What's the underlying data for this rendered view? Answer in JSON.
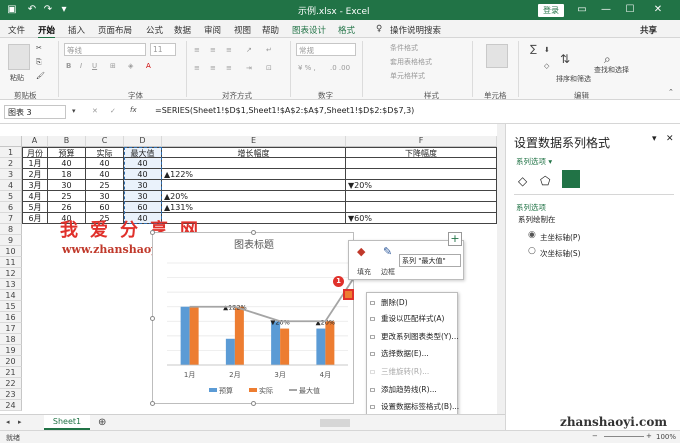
{
  "titlebar": {
    "file_title": "示例.xlsx  -  Excel",
    "login": "登录",
    "restore_icon": "ribbon-display-icon",
    "min": "—",
    "max": "☐",
    "close": "✕"
  },
  "tabs": [
    "文件",
    "开始",
    "插入",
    "页面布局",
    "公式",
    "数据",
    "审阅",
    "视图",
    "帮助",
    "图表设计",
    "格式",
    "操作说明搜索",
    "共享"
  ],
  "ribbon": {
    "paste": "粘贴",
    "clipboard": "剪贴板",
    "font_name": "等线",
    "font_size": "11",
    "font_group": "字体",
    "align_group": "对齐方式",
    "number_format": "常规",
    "number_group": "数字",
    "cond_format": "条件格式",
    "table_format": "套用表格格式",
    "cell_style": "单元格样式",
    "styles_group": "样式",
    "cells": "单元格",
    "sum": "∑",
    "sort_filter": "排序和筛选",
    "find_select": "查找和选择",
    "edit_group": "编辑"
  },
  "formula_bar": {
    "name_box": "图表 3",
    "fx": "fx",
    "formula": "=SERIES(Sheet1!$D$1,Sheet1!$A$2:$A$7,Sheet1!$D$2:$D$7,3)"
  },
  "columns": [
    "A",
    "B",
    "C",
    "D",
    "E",
    "F"
  ],
  "rows": [
    "1",
    "2",
    "3",
    "4",
    "5",
    "6",
    "7",
    "8",
    "9",
    "10",
    "11",
    "12",
    "13",
    "14",
    "15",
    "16",
    "17",
    "18",
    "19",
    "20",
    "21",
    "22",
    "23",
    "24"
  ],
  "table": {
    "headers": [
      "月份",
      "预算",
      "实际",
      "最大值",
      "增长幅度",
      "下降幅度"
    ],
    "data": [
      [
        "1月",
        "40",
        "40",
        "40",
        "",
        ""
      ],
      [
        "2月",
        "18",
        "40",
        "40",
        "▲122%",
        ""
      ],
      [
        "3月",
        "30",
        "25",
        "30",
        "",
        "▼20%"
      ],
      [
        "4月",
        "25",
        "30",
        "30",
        "▲20%",
        ""
      ],
      [
        "5月",
        "26",
        "60",
        "60",
        "▲131%",
        ""
      ],
      [
        "6月",
        "40",
        "25",
        "40",
        "",
        "▼60%"
      ]
    ]
  },
  "watermark": {
    "text": "我爱分享网",
    "url": "www.zhanshaoyi.com",
    "url2": "zhanshaoyi.com"
  },
  "chart_data": {
    "type": "bar",
    "title": "图表标题",
    "categories": [
      "1月",
      "2月",
      "3月",
      "4月"
    ],
    "series": [
      {
        "name": "预算",
        "values": [
          40,
          18,
          30,
          25
        ],
        "color": "#5b9bd5"
      },
      {
        "name": "实际",
        "values": [
          40,
          40,
          25,
          30
        ],
        "color": "#ed7d31"
      },
      {
        "name": "最大值",
        "values": [
          40,
          40,
          30,
          30
        ],
        "color": "#a5a5a5",
        "type": "line"
      }
    ],
    "point_labels": [
      "",
      "▲122%",
      "▼20%",
      "▲20%"
    ],
    "ylim": [
      0,
      70
    ],
    "legend": "bottom"
  },
  "mini_toolbar": {
    "fill": "填充",
    "outline": "边框",
    "series_select": "系列 \"最大值\""
  },
  "context_menu": [
    {
      "label": "删除(D)",
      "enabled": true
    },
    {
      "label": "重设以匹配样式(A)",
      "enabled": true
    },
    {
      "label": "更改系列图表类型(Y)...",
      "enabled": true
    },
    {
      "label": "选择数据(E)...",
      "enabled": true
    },
    {
      "label": "三维旋转(R)...",
      "enabled": false
    },
    {
      "label": "添加趋势线(R)...",
      "enabled": true
    },
    {
      "label": "设置数据标签格式(B)...",
      "enabled": true
    },
    {
      "label": "设置数据系列格式(F)...",
      "enabled": true
    }
  ],
  "badges": [
    "1",
    "2"
  ],
  "pane": {
    "title": "设置数据系列格式",
    "dropdown": "系列选项 ▾",
    "section": "系列选项",
    "plot_on": "系列绘制在",
    "radio_primary": "主坐标轴(P)",
    "radio_secondary": "次坐标轴(S)",
    "close": "✕",
    "pin": "▾"
  },
  "sheet_tab": "Sheet1",
  "status": {
    "left": "就绪",
    "zoom": "100%",
    "zoom_minus": "−",
    "zoom_plus": "+"
  },
  "colors": {
    "excel_green": "#217346",
    "accent_red": "#e0312b"
  }
}
